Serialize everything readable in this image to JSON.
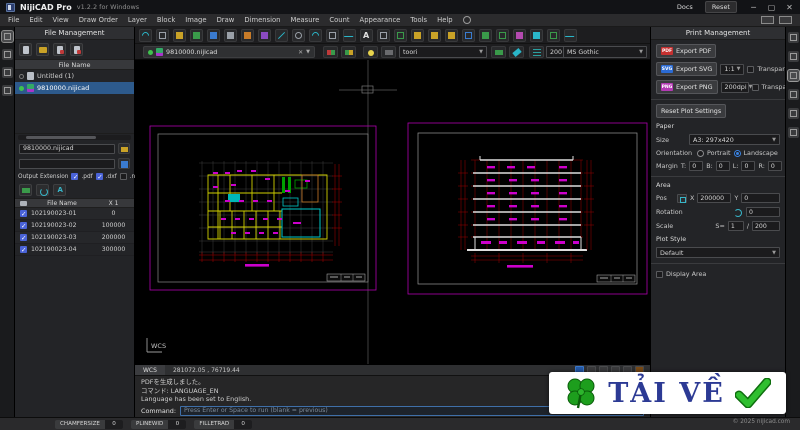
{
  "titlebar": {
    "app": "NijiCAD Pro",
    "version": "v1.2.2 for Windows",
    "docs": "Docs",
    "reset": "Reset"
  },
  "menubar": {
    "items": [
      "File",
      "Edit",
      "View",
      "Draw Order",
      "Layer",
      "Block",
      "Image",
      "Draw",
      "Dimension",
      "Measure",
      "Count",
      "Appearance",
      "Tools",
      "Help"
    ]
  },
  "toolbar": {
    "layer": "toori",
    "lineweight": "200",
    "text_height": "200",
    "font": "MS Gothic"
  },
  "doc_tab": {
    "name": "9810000.nijicad"
  },
  "file_panel": {
    "title": "File Management",
    "list_header": "File Name",
    "files": [
      {
        "name": "Untitled (1)",
        "status": "closed"
      },
      {
        "name": "9810000.nijicad",
        "status": "open",
        "selected": true
      }
    ],
    "output_name": "9810000.nijicad",
    "output_ext_label": "Output Extension",
    "extensions": [
      {
        "label": ".pdf",
        "checked": true
      },
      {
        "label": ".dxf",
        "checked": true
      },
      {
        "label": ".nijicad",
        "checked": false
      }
    ],
    "batch_table": {
      "name_header": "File Name",
      "x_header": "X 1",
      "rows": [
        {
          "name": "102190023-01",
          "x": "0",
          "checked": true
        },
        {
          "name": "102190023-02",
          "x": "100000",
          "checked": true
        },
        {
          "name": "102190023-03",
          "x": "200000",
          "checked": true
        },
        {
          "name": "102190023-04",
          "x": "300000",
          "checked": true
        }
      ]
    }
  },
  "print_panel": {
    "title": "Print Management",
    "badges": {
      "pdf": "PDF",
      "svg": "SVG",
      "png": "PNG"
    },
    "export_pdf": "Export PDF",
    "export_svg": "Export SVG",
    "svg_scale": "1:1",
    "export_png": "Export PNG",
    "png_dpi": "200dpi",
    "transparent": "Transparent",
    "reset_plot": "Reset Plot Settings",
    "paper": {
      "title": "Paper",
      "size_label": "Size",
      "size_value": "A3: 297x420",
      "orientation_label": "Orientation",
      "portrait": "Portrait",
      "landscape": "Landscape",
      "margin_label": "Margin",
      "t": "T:",
      "b": "B:",
      "l": "L:",
      "r": "R:",
      "tv": "0",
      "bv": "0",
      "lv": "0",
      "rv": "0"
    },
    "area": {
      "title": "Area",
      "pos_label": "Pos",
      "x_label": "X",
      "x_value": "200000",
      "y_label": "Y",
      "y_value": "0",
      "rotation_label": "Rotation",
      "rotation_value": "0",
      "scale_label": "Scale",
      "s_label": "S=",
      "scale_num": "1",
      "scale_slash": "/",
      "scale_den": "200"
    },
    "plot_style": {
      "label": "Plot Style",
      "value": "Default"
    },
    "display_area": "Display Area"
  },
  "canvas": {
    "wcs_label": "WCS"
  },
  "wcs_bar": {
    "label": "WCS",
    "coords": "281072.05 , 76719.44"
  },
  "console": {
    "lines": [
      "PDFを生成しました。",
      "コマンド: LANGUAGE_EN",
      "Language has been set to English."
    ],
    "command_label": "Command:",
    "command_placeholder": "Press Enter or Space to run (blank = previous)"
  },
  "bottom_status": {
    "items": [
      {
        "label": "CHAMFERSIZE",
        "value": "0"
      },
      {
        "label": "PLINEWID",
        "value": "0"
      },
      {
        "label": "FILLETRAD",
        "value": "0"
      }
    ]
  },
  "watermark": {
    "text": "TẢI VỀ"
  },
  "copyright": "© 2025 nijicad.com"
}
